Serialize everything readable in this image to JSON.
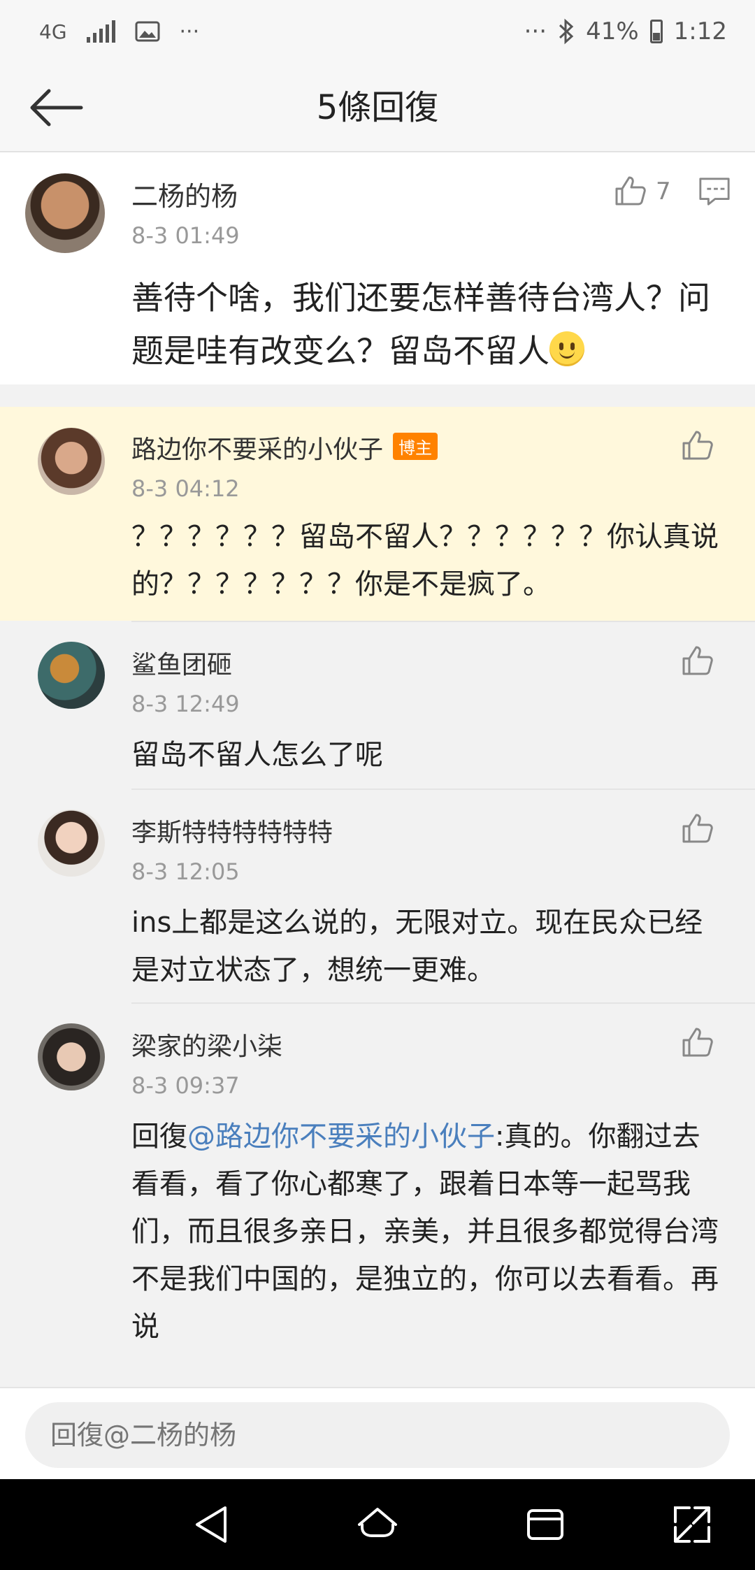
{
  "status_bar": {
    "network": "4G",
    "more_left": "···",
    "more_right": "···",
    "battery": "41%",
    "time": "1:12"
  },
  "header": {
    "title": "5條回復",
    "back_icon": "arrow-left-icon"
  },
  "main_comment": {
    "username": "二杨的杨",
    "time": "8-3 01:49",
    "likes": "7",
    "text": "善待个啥，我们还要怎样善待台湾人？问题是哇有改变么？留岛不留人",
    "emoji": "smile-emoji"
  },
  "replies": [
    {
      "username": "路边你不要采的小伙子",
      "badge": "博主",
      "time": "8-3 04:12",
      "text": "？？？？？？留岛不留人？？？？？？你认真说的？？？？？？？你是不是疯了。",
      "highlight_color": "#fff8dc"
    },
    {
      "username": "鲨鱼团砸",
      "time": "8-3 12:49",
      "text": "留岛不留人怎么了呢"
    },
    {
      "username": "李斯特特特特特特",
      "time": "8-3 12:05",
      "text": "ins上都是这么说的，无限对立。现在民众已经是对立状态了，想统一更难。"
    },
    {
      "username": "梁家的梁小柒",
      "time": "8-3 09:37",
      "reply_prefix": "回復",
      "mention": "@路边你不要采的小伙子",
      "text": ":真的。你翻过去看看，看了你心都寒了，跟着日本等一起骂我们，而且很多亲日，亲美，并且很多都觉得台湾不是我们中国的，是独立的，你可以去看看。再说"
    }
  ],
  "reply_input": {
    "placeholder": "回復@二杨的杨"
  },
  "nav": {
    "back": "triangle-back-icon",
    "home": "home-icon",
    "recents": "recents-icon",
    "expand": "expand-icon"
  },
  "colors": {
    "accent_badge": "#ff8200",
    "mention": "#4a7fbd",
    "highlight": "#fff8dc"
  }
}
